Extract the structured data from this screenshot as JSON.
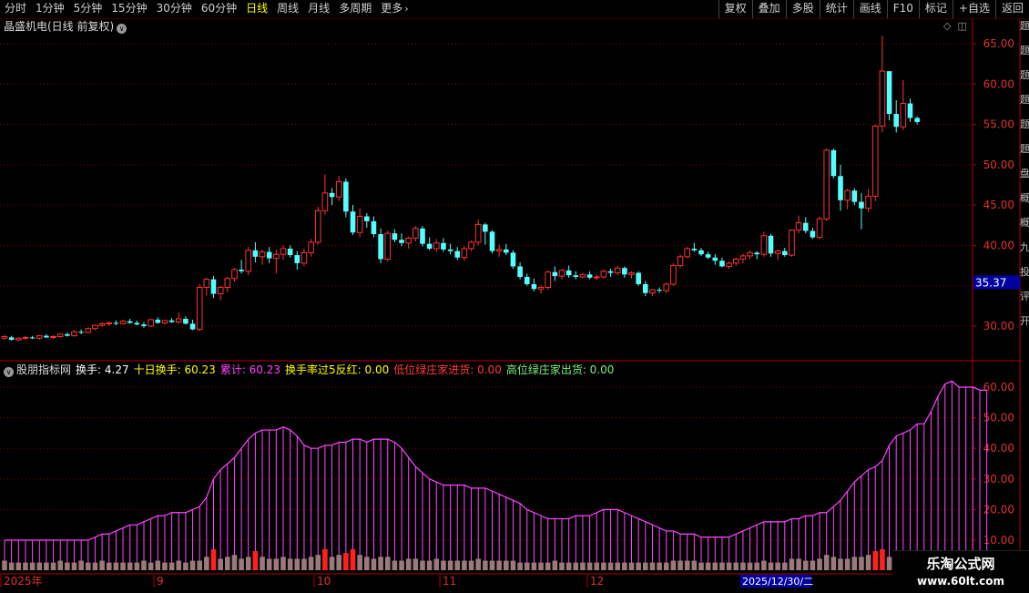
{
  "toolbar": {
    "periods": [
      "分时",
      "1分钟",
      "5分钟",
      "15分钟",
      "30分钟",
      "60分钟",
      "日线",
      "周线",
      "月线",
      "多周期"
    ],
    "active_period": "日线",
    "more_label": "更多",
    "right_buttons": [
      "复权",
      "叠加",
      "多股",
      "统计",
      "画线",
      "F10",
      "标记",
      "+自选",
      "返回"
    ]
  },
  "main_chart": {
    "title": "晶盛机电(日线 前复权)",
    "price_axis": [
      65.0,
      60.0,
      55.0,
      50.0,
      45.0,
      40.0,
      35.0,
      30.0
    ],
    "current_price_label": "35.37"
  },
  "indicator": {
    "name": "股朋指标网",
    "items": [
      {
        "label": "换手:",
        "value": "4.27",
        "color": "white"
      },
      {
        "label": "十日换手:",
        "value": "60.23",
        "color": "yellow"
      },
      {
        "label": "累计:",
        "value": "60.23",
        "color": "magenta"
      },
      {
        "label": "换手率过5反红:",
        "value": "0.00",
        "color": "yellow"
      },
      {
        "label": "低位绿庄家进货:",
        "value": "0.00",
        "color": "red"
      },
      {
        "label": "高位绿庄家出货:",
        "value": "0.00",
        "color": "green"
      }
    ],
    "axis": [
      60.0,
      50.0,
      40.0,
      30.0,
      20.0,
      10.0
    ]
  },
  "date_axis": {
    "labels": [
      "2025年",
      "9",
      "10",
      "11",
      "12"
    ],
    "cursor_date": "2025/12/30/二"
  },
  "right_strip": [
    "题",
    "题",
    "题",
    "题",
    "题",
    "题",
    "盘",
    "概",
    "概",
    "九",
    "投",
    "评",
    "开"
  ],
  "watermark": {
    "title": "乐淘公式网",
    "url": "www.60lt.com"
  },
  "colors": {
    "up": "#ff3232",
    "down": "#54ffff",
    "grid": "#8b0000",
    "cumulative": "#ff44ff",
    "volume": "#9a7a7a"
  },
  "candles": [
    [
      28.5,
      28.9,
      28.3,
      28.7
    ],
    [
      28.6,
      28.8,
      28.2,
      28.3
    ],
    [
      28.3,
      28.6,
      28.1,
      28.5
    ],
    [
      28.5,
      28.8,
      28.3,
      28.6
    ],
    [
      28.6,
      28.8,
      28.4,
      28.5
    ],
    [
      28.5,
      28.9,
      28.3,
      28.8
    ],
    [
      28.8,
      29.0,
      28.5,
      28.6
    ],
    [
      28.6,
      28.9,
      28.4,
      28.7
    ],
    [
      28.7,
      29.1,
      28.6,
      29.0
    ],
    [
      29.0,
      29.2,
      28.7,
      28.8
    ],
    [
      28.8,
      29.5,
      28.7,
      29.3
    ],
    [
      29.3,
      29.6,
      29.0,
      29.2
    ],
    [
      29.2,
      29.8,
      29.1,
      29.7
    ],
    [
      29.7,
      30.2,
      29.5,
      30.1
    ],
    [
      30.1,
      30.5,
      29.9,
      30.3
    ],
    [
      30.3,
      30.6,
      30.0,
      30.4
    ],
    [
      30.4,
      30.7,
      30.1,
      30.3
    ],
    [
      30.3,
      30.8,
      30.2,
      30.6
    ],
    [
      30.6,
      30.9,
      30.3,
      30.4
    ],
    [
      30.4,
      30.7,
      30.1,
      30.2
    ],
    [
      30.2,
      30.5,
      29.8,
      30.0
    ],
    [
      30.0,
      30.9,
      29.9,
      30.8
    ],
    [
      30.8,
      31.1,
      30.3,
      30.4
    ],
    [
      30.4,
      30.8,
      30.2,
      30.7
    ],
    [
      30.7,
      31.0,
      30.4,
      30.5
    ],
    [
      30.5,
      31.7,
      30.3,
      30.9
    ],
    [
      30.9,
      31.2,
      30.2,
      30.3
    ],
    [
      30.3,
      30.8,
      29.5,
      29.6
    ],
    [
      29.6,
      35.2,
      29.4,
      34.8
    ],
    [
      34.8,
      36.0,
      33.8,
      35.8
    ],
    [
      35.8,
      36.2,
      33.5,
      34.0
    ],
    [
      34.0,
      35.0,
      33.2,
      34.8
    ],
    [
      34.8,
      36.1,
      34.2,
      35.9
    ],
    [
      35.9,
      37.2,
      35.5,
      37.0
    ],
    [
      37.0,
      38.2,
      36.5,
      36.8
    ],
    [
      36.8,
      39.8,
      36.3,
      39.4
    ],
    [
      39.4,
      40.4,
      37.9,
      38.6
    ],
    [
      38.6,
      39.5,
      37.6,
      39.2
    ],
    [
      39.2,
      39.8,
      37.8,
      38.4
    ],
    [
      38.4,
      39.5,
      36.5,
      38.9
    ],
    [
      38.9,
      40.0,
      38.2,
      39.6
    ],
    [
      39.6,
      40.0,
      38.5,
      38.8
    ],
    [
      38.8,
      39.3,
      37.0,
      37.8
    ],
    [
      37.8,
      39.6,
      37.4,
      39.1
    ],
    [
      39.1,
      40.8,
      38.6,
      40.4
    ],
    [
      40.4,
      44.8,
      40.1,
      44.3
    ],
    [
      44.3,
      48.8,
      43.8,
      46.5
    ],
    [
      46.5,
      47.1,
      45.0,
      46.0
    ],
    [
      46.0,
      48.6,
      45.5,
      47.9
    ],
    [
      47.9,
      48.3,
      43.5,
      44.2
    ],
    [
      44.2,
      45.0,
      41.3,
      41.6
    ],
    [
      41.6,
      44.6,
      41.0,
      43.6
    ],
    [
      43.6,
      44.0,
      42.2,
      43.0
    ],
    [
      43.0,
      43.6,
      41.0,
      41.4
    ],
    [
      41.4,
      42.1,
      37.8,
      38.3
    ],
    [
      38.3,
      41.8,
      38.0,
      41.5
    ],
    [
      41.5,
      42.0,
      40.4,
      40.7
    ],
    [
      40.7,
      41.5,
      39.9,
      40.3
    ],
    [
      40.3,
      41.1,
      39.6,
      40.9
    ],
    [
      40.9,
      42.4,
      40.5,
      42.1
    ],
    [
      42.1,
      42.4,
      39.9,
      40.2
    ],
    [
      40.2,
      41.0,
      39.4,
      39.6
    ],
    [
      39.6,
      40.8,
      39.2,
      40.3
    ],
    [
      40.3,
      40.9,
      39.2,
      39.5
    ],
    [
      39.5,
      40.2,
      38.9,
      39.3
    ],
    [
      39.3,
      39.8,
      38.2,
      38.5
    ],
    [
      38.5,
      39.9,
      38.1,
      39.6
    ],
    [
      39.6,
      40.6,
      39.3,
      40.4
    ],
    [
      40.4,
      43.2,
      40.0,
      42.6
    ],
    [
      42.6,
      42.8,
      40.1,
      41.7
    ],
    [
      41.7,
      41.9,
      39.0,
      39.3
    ],
    [
      39.3,
      40.1,
      38.6,
      39.5
    ],
    [
      39.5,
      40.2,
      38.8,
      39.1
    ],
    [
      39.1,
      39.4,
      37.1,
      37.4
    ],
    [
      37.4,
      37.9,
      35.8,
      36.1
    ],
    [
      36.1,
      36.5,
      35.0,
      35.2
    ],
    [
      35.2,
      35.9,
      34.3,
      34.6
    ],
    [
      34.6,
      35.1,
      34.0,
      34.8
    ],
    [
      34.8,
      36.9,
      34.5,
      36.7
    ],
    [
      36.7,
      37.4,
      35.6,
      36.2
    ],
    [
      36.2,
      37.1,
      35.8,
      36.9
    ],
    [
      36.9,
      37.5,
      36.0,
      36.3
    ],
    [
      36.3,
      36.8,
      35.8,
      36.1
    ],
    [
      36.1,
      36.6,
      35.9,
      36.4
    ],
    [
      36.4,
      36.8,
      35.8,
      36.0
    ],
    [
      36.0,
      36.4,
      35.7,
      36.1
    ],
    [
      36.1,
      37.0,
      35.9,
      36.8
    ],
    [
      36.8,
      37.1,
      36.1,
      36.6
    ],
    [
      36.6,
      37.5,
      36.3,
      37.2
    ],
    [
      37.2,
      37.4,
      36.0,
      36.4
    ],
    [
      36.4,
      36.8,
      35.9,
      36.6
    ],
    [
      36.6,
      36.8,
      35.0,
      35.2
    ],
    [
      35.2,
      35.6,
      33.7,
      34.1
    ],
    [
      34.1,
      34.6,
      33.7,
      34.5
    ],
    [
      34.5,
      34.8,
      34.1,
      34.4
    ],
    [
      34.4,
      35.4,
      34.1,
      35.2
    ],
    [
      35.2,
      37.8,
      35.0,
      37.5
    ],
    [
      37.5,
      38.9,
      37.2,
      38.6
    ],
    [
      38.6,
      39.8,
      38.4,
      39.6
    ],
    [
      39.6,
      40.3,
      39.2,
      39.4
    ],
    [
      39.4,
      39.7,
      38.7,
      38.9
    ],
    [
      38.9,
      39.2,
      38.3,
      38.5
    ],
    [
      38.5,
      38.9,
      37.6,
      38.1
    ],
    [
      38.1,
      38.5,
      37.3,
      37.4
    ],
    [
      37.4,
      38.0,
      37.1,
      37.8
    ],
    [
      37.8,
      38.5,
      37.5,
      38.3
    ],
    [
      38.3,
      39.0,
      37.8,
      38.7
    ],
    [
      38.7,
      39.4,
      38.3,
      39.1
    ],
    [
      39.1,
      39.3,
      38.3,
      38.9
    ],
    [
      38.9,
      41.7,
      38.6,
      41.2
    ],
    [
      41.2,
      41.4,
      38.6,
      39.0
    ],
    [
      39.0,
      39.5,
      38.2,
      39.3
    ],
    [
      39.3,
      39.7,
      38.6,
      38.8
    ],
    [
      38.8,
      42.0,
      38.6,
      41.9
    ],
    [
      41.9,
      43.7,
      41.5,
      42.8
    ],
    [
      42.8,
      43.5,
      41.5,
      41.8
    ],
    [
      41.8,
      42.2,
      40.8,
      41.0
    ],
    [
      41.0,
      43.6,
      40.8,
      43.3
    ],
    [
      43.3,
      52.0,
      43.0,
      51.8
    ],
    [
      51.8,
      52.0,
      48.3,
      48.6
    ],
    [
      48.6,
      50.0,
      44.3,
      45.6
    ],
    [
      45.6,
      47.0,
      44.5,
      46.8
    ],
    [
      46.8,
      47.1,
      45.0,
      45.4
    ],
    [
      45.4,
      46.5,
      42.0,
      44.6
    ],
    [
      44.6,
      47.0,
      44.1,
      46.1
    ],
    [
      46.1,
      55.0,
      45.5,
      54.8
    ],
    [
      54.8,
      66.0,
      54.0,
      61.6
    ],
    [
      61.6,
      59.0,
      55.5,
      56.3
    ],
    [
      56.3,
      58.0,
      54.0,
      54.7
    ],
    [
      54.7,
      60.5,
      54.3,
      57.6
    ],
    [
      57.6,
      58.2,
      55.3,
      55.8
    ],
    [
      55.8,
      56.0,
      55.0,
      55.3
    ]
  ],
  "turnover": [
    5,
    4,
    4,
    4,
    4,
    4,
    4,
    4,
    5,
    4,
    4,
    5,
    4,
    4,
    5,
    4,
    4,
    4,
    4,
    4,
    5,
    4,
    5,
    4,
    4,
    5,
    4,
    5,
    5,
    7,
    11,
    6,
    7,
    8,
    6,
    7,
    10,
    7,
    6,
    6,
    7,
    6,
    6,
    6,
    7,
    8,
    11,
    7,
    8,
    9,
    11,
    8,
    7,
    6,
    7,
    7,
    5,
    5,
    6,
    6,
    5,
    5,
    6,
    5,
    5,
    5,
    5,
    5,
    6,
    5,
    5,
    5,
    5,
    5,
    4,
    4,
    4,
    4,
    4,
    5,
    4,
    4,
    4,
    4,
    4,
    4,
    4,
    4,
    4,
    4,
    4,
    4,
    4,
    4,
    4,
    4,
    5,
    5,
    5,
    5,
    4,
    4,
    4,
    4,
    4,
    4,
    4,
    4,
    4,
    5,
    4,
    4,
    4,
    6,
    6,
    5,
    5,
    6,
    8,
    7,
    6,
    6,
    7,
    7,
    8,
    10,
    11,
    7,
    9,
    10,
    8,
    4
  ],
  "cumulative": [
    10,
    10,
    10,
    10,
    10,
    10,
    10,
    10,
    10,
    10,
    10,
    10,
    10,
    11,
    12,
    12,
    13,
    14,
    15,
    15,
    16,
    17,
    18,
    18,
    19,
    19,
    19,
    20,
    21,
    24,
    30,
    33,
    35,
    37,
    40,
    43,
    45,
    46,
    46,
    46,
    47,
    46,
    44,
    41,
    40,
    40,
    41,
    41,
    42,
    42,
    43,
    43,
    42,
    43,
    43,
    43,
    42,
    40,
    37,
    34,
    32,
    30,
    29,
    28,
    28,
    28,
    28,
    27,
    27,
    27,
    26,
    25,
    24,
    23,
    22,
    20,
    19,
    18,
    17,
    17,
    17,
    17,
    18,
    18,
    18,
    19,
    20,
    20,
    20,
    19,
    18,
    17,
    16,
    15,
    14,
    13,
    13,
    12,
    12,
    12,
    11,
    11,
    11,
    11,
    11,
    12,
    13,
    14,
    15,
    16,
    16,
    16,
    16,
    17,
    17,
    18,
    18,
    19,
    19,
    21,
    23,
    26,
    29,
    31,
    33,
    34,
    36,
    41,
    44,
    45,
    46,
    48,
    48,
    52,
    57,
    61,
    62,
    60,
    60,
    60,
    59,
    59
  ]
}
